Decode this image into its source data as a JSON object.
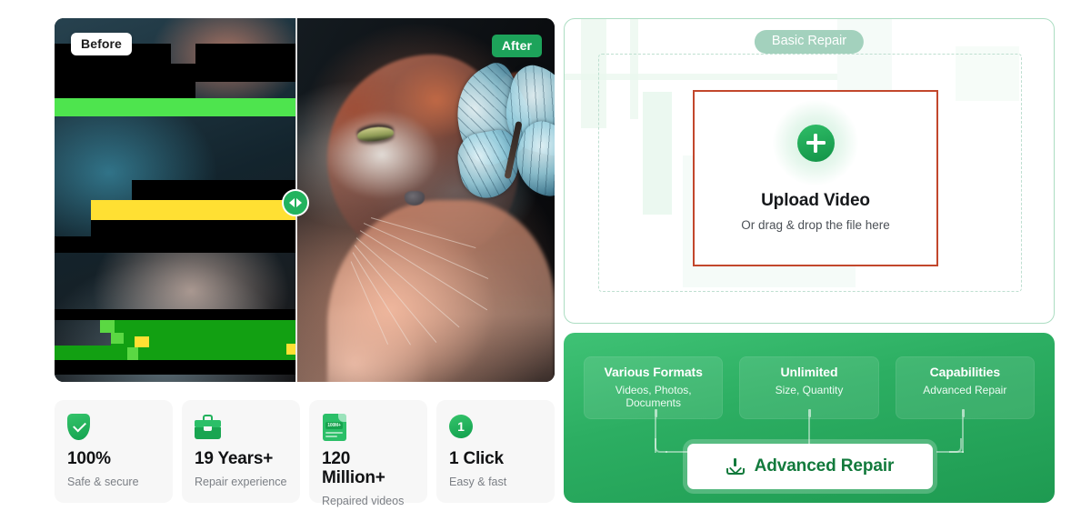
{
  "comparison": {
    "before_label": "Before",
    "after_label": "After",
    "slider_handle": "drag-slider-handle"
  },
  "stats": [
    {
      "icon": "shield-check-icon",
      "value": "100%",
      "label": "Safe & secure"
    },
    {
      "icon": "toolbox-icon",
      "value": "19 Years+",
      "label": "Repair experience"
    },
    {
      "icon": "file-100m-icon",
      "value": "120 Million+",
      "label": "Repaired videos",
      "badge_text": "100M+"
    },
    {
      "icon": "number-one-icon",
      "value": "1 Click",
      "label": "Easy & fast",
      "badge_text": "1"
    }
  ],
  "basic_panel": {
    "tab_label": "Basic Repair",
    "upload_title": "Upload Video",
    "upload_subtitle": "Or drag & drop the file here",
    "plus_icon": "plus-icon",
    "highlight_color": "#C2472C",
    "dashed_border_color": "#BEDFD0",
    "panel_border_color": "#ACDDC2"
  },
  "advanced_panel": {
    "features": [
      {
        "title": "Various Formats",
        "subtitle": "Videos, Photos, Documents"
      },
      {
        "title": "Unlimited",
        "subtitle": "Size, Quantity"
      },
      {
        "title": "Capabilities",
        "subtitle": "Advanced Repair"
      }
    ],
    "button_label": "Advanced Repair",
    "button_icon": "download-icon",
    "gradient_from": "#3FC275",
    "gradient_to": "#1E9A51",
    "button_text_color": "#127A3C"
  }
}
